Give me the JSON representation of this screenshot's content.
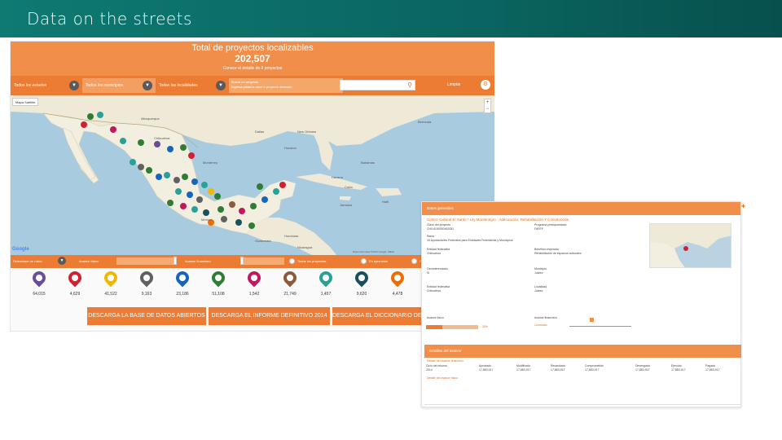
{
  "slide": {
    "title": "Data on the streets"
  },
  "top": {
    "total_title": "Total de proyectos localizables",
    "total_num": "202,507",
    "conoce": "Conoce el detalle de 8 proyectos"
  },
  "filters": {
    "estados": "Todos los estados",
    "municipios": "Todos los municipios",
    "localidades": "Todas las localidades",
    "note_line1": "Busca un proyecto",
    "note_line2": "Ingresa palabra clave o proyecto deseado",
    "search_placeholder": "",
    "limpiar": "Limpiar"
  },
  "map": {
    "toggle": "Mapa  Satélite",
    "google": "Google",
    "attrib": "Datos del mapa ©2014 Google, INEGI",
    "labels": [
      "Albuquerque",
      "Dallas",
      "Houston",
      "Chihuahua",
      "Monterrey",
      "Mexico",
      "Havana",
      "Cuba",
      "Guatemala",
      "Honduras",
      "Nicaragua",
      "Jamaica",
      "Haiti",
      "Bermuda",
      "Bahamas",
      "New Orleans"
    ]
  },
  "slider_bar": {
    "seleccione": "Seleccione un rubro",
    "avance_fisico": "Avance físico",
    "avance_financiero": "Avance financiero",
    "todos": "Todos los proyectos",
    "ejecucion": "En ejecución",
    "concluidos": "Concluido"
  },
  "categories": [
    {
      "icon": "target-icon",
      "color": "#6b4c9a",
      "count": "64,015"
    },
    {
      "icon": "health-icon",
      "color": "#d32030",
      "count": "4,629"
    },
    {
      "icon": "pencil-icon",
      "color": "#f2b705",
      "count": "41,522"
    },
    {
      "icon": "truck-icon",
      "color": "#616161",
      "count": "9,163"
    },
    {
      "icon": "water-icon",
      "color": "#1565c0",
      "count": "23,186"
    },
    {
      "icon": "building-icon",
      "color": "#2e7d32",
      "count": "51,108"
    },
    {
      "icon": "culture-icon",
      "color": "#c2185b",
      "count": "1,542"
    },
    {
      "icon": "house-icon",
      "color": "#8d5b3a",
      "count": "21,749"
    },
    {
      "icon": "recycle-icon",
      "color": "#2aa198",
      "count": "1,457"
    },
    {
      "icon": "road-icon",
      "color": "#1b4f5a",
      "count": "9,620"
    },
    {
      "icon": "home-icon",
      "color": "#ef6c00",
      "count": "4,478"
    }
  ],
  "downloads": {
    "btn1": "DESCARGA LA BASE DE DATOS ABIERTOS",
    "btn2": "DESCARGA EL INFORME DEFINITIVO 2014",
    "btn3": "DESCARGA EL DICCIONARIO DE DATOS"
  },
  "detail": {
    "header": "Datos generales",
    "project_title": "Centro Cultural El Santo * Lily Montenegro - Adecuación, Rehabilitación Y Construcción",
    "lines": [
      {
        "label": "Clave del proyecto",
        "value": "CHI14150300452051"
      },
      {
        "label": "Programa presupuestario",
        "value": "FAFEF"
      },
      {
        "label": "Ramo",
        "value": "33 Aportaciones Federales para Entidades Federativas y Municipios"
      },
      {
        "label": "Entidad federativa",
        "value": "Chihuahua"
      },
      {
        "label": "Beneficio esperado",
        "value": "Rehabilitación de espacios culturales"
      },
      {
        "label": "Georeferenciado",
        "value": "Sí"
      },
      {
        "label": "Municipio",
        "value": "Juárez"
      },
      {
        "label": "Entidad federativa",
        "value": "Chihuahua"
      },
      {
        "label": "Localidad",
        "value": "Juárez"
      },
      {
        "label": "Avance físico",
        "value": "30%"
      },
      {
        "label": "Avance financiero",
        "value": "Concluido"
      }
    ],
    "section2": "Detalles del avance",
    "subhead1": "Detalle del avance financiero",
    "subhead2": "Detalle del avance físico",
    "fin_headers": [
      "Ciclo del recurso",
      "Aprobado",
      "Modificado",
      "Recaudado",
      "Comprometido",
      "Devengado",
      "Ejercido",
      "Pagado"
    ],
    "fin_values": [
      "2014",
      "17,883,917",
      "17,883,917",
      "17,883,917",
      "17,883,917",
      "17,883,917",
      "17,883,917",
      "17,883,917"
    ]
  },
  "colors": {
    "accent": "#ec7b33",
    "header_teal": "#0a6560"
  }
}
